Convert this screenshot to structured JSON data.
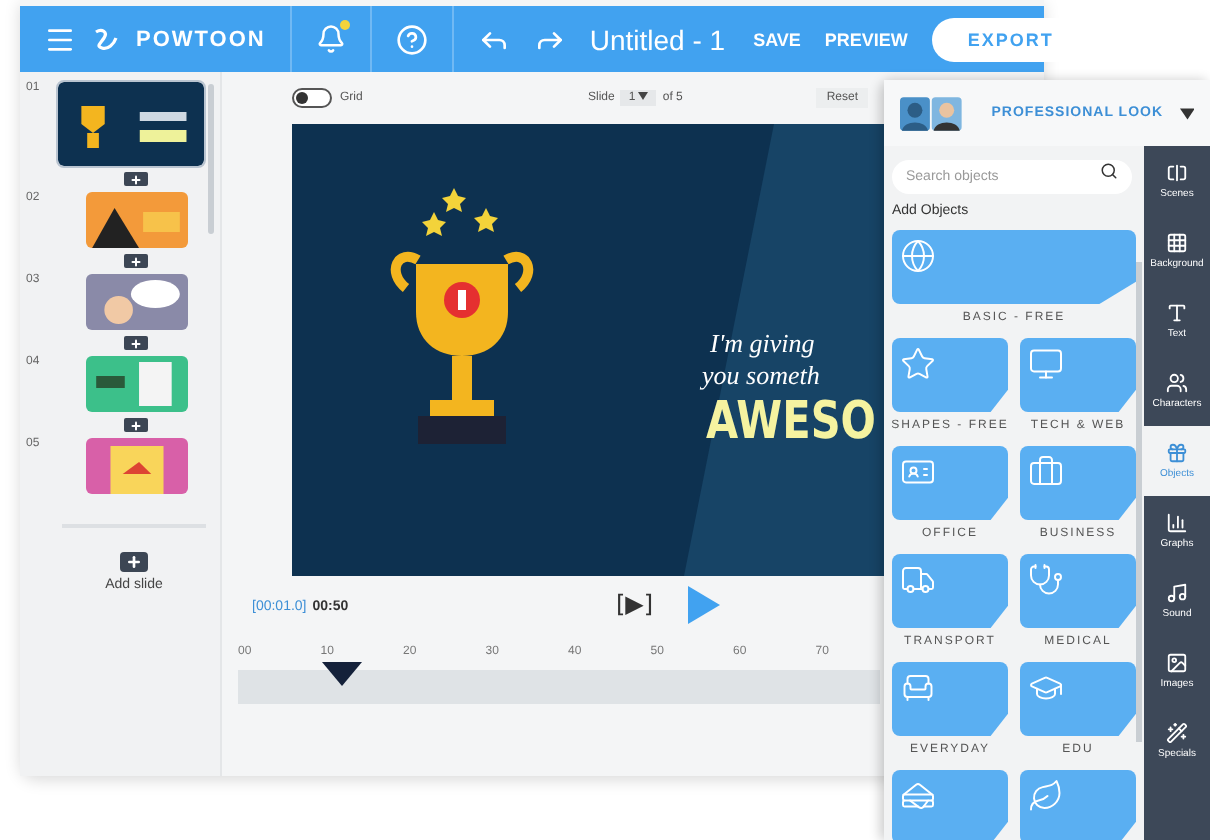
{
  "topbar": {
    "logo": "POWTOON",
    "notification": true,
    "title": "Untitled - 1",
    "actions": [
      "SAVE",
      "PREVIEW"
    ],
    "export": "EXPORT"
  },
  "slides": {
    "items": [
      {
        "number": "01",
        "selected": true
      },
      {
        "number": "02",
        "selected": false
      },
      {
        "number": "03",
        "selected": false
      },
      {
        "number": "04",
        "selected": false
      },
      {
        "number": "05",
        "selected": false
      }
    ],
    "add_slide": "Add slide"
  },
  "editor": {
    "grid": {
      "label": "Grid",
      "on": false
    },
    "slide_label": "Slide",
    "slide_value": "1",
    "slide_total": "of 5",
    "reset": "Reset",
    "canvas": {
      "line_1": "I'm giving",
      "line_2": "you someth",
      "headline": "AWESO"
    },
    "player": {
      "current": "[00:01.0]",
      "total": "00:50",
      "play_mode": "[▶]"
    },
    "timeline": {
      "ticks": [
        "00",
        "10",
        "20",
        "30",
        "40",
        "50",
        "60",
        "70"
      ],
      "level": 0.14
    }
  },
  "panel": {
    "title": "PROFESSIONAL LOOK",
    "search": {
      "placeholder": "Search objects"
    },
    "section": "Add Objects",
    "tiles": [
      {
        "label": "BASIC - FREE",
        "kind": "wide"
      },
      {
        "label": "SHAPES - FREE",
        "kind": "half"
      },
      {
        "label": "TECH & WEB",
        "kind": "half"
      },
      {
        "label": "OFFICE",
        "kind": "half"
      },
      {
        "label": "BUSINESS",
        "kind": "half"
      },
      {
        "label": "TRANSPORT",
        "kind": "half"
      },
      {
        "label": "MEDICAL",
        "kind": "half"
      },
      {
        "label": "EVERYDAY",
        "kind": "half"
      },
      {
        "label": "EDU",
        "kind": "half"
      },
      {
        "kind": "half"
      },
      {
        "kind": "half"
      }
    ],
    "rail": [
      {
        "label": "Scenes",
        "selected": false
      },
      {
        "label": "Background",
        "selected": false
      },
      {
        "label": "Text",
        "selected": false
      },
      {
        "label": "Characters",
        "selected": false
      },
      {
        "label": "Objects",
        "selected": true
      },
      {
        "label": "Graphs",
        "selected": false
      },
      {
        "label": "Sound",
        "selected": false
      },
      {
        "label": "Images",
        "selected": false
      },
      {
        "label": "Specials",
        "selected": false
      }
    ]
  }
}
